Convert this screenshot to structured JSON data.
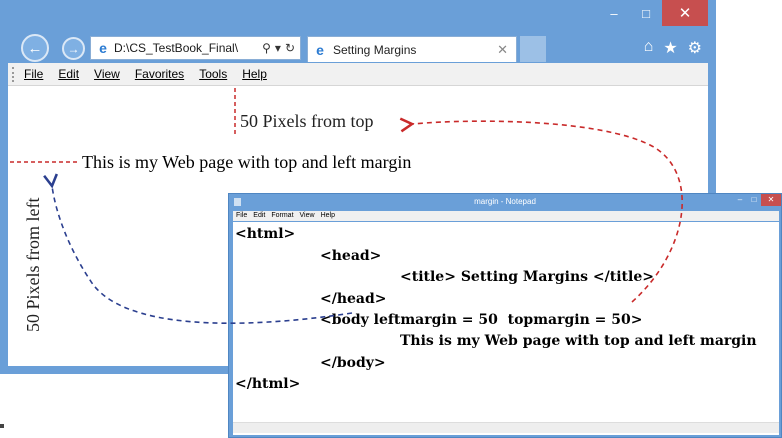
{
  "browser": {
    "url": "D:\\CS_TestBook_Final\\",
    "tab_title": "Setting Margins",
    "menu": [
      "File",
      "Edit",
      "View",
      "Favorites",
      "Tools",
      "Help"
    ],
    "window_buttons": {
      "minimize": "–",
      "maximize": "□",
      "close": "✕"
    }
  },
  "page": {
    "text": "This is my Web page with top and left margin"
  },
  "annotations": {
    "top": "50 Pixels from top",
    "left": "50 Pixels from left"
  },
  "notepad": {
    "title": "margin - Notepad",
    "menu": [
      "File",
      "Edit",
      "Format",
      "View",
      "Help"
    ],
    "lines": [
      "<html>",
      "<head>",
      "<title> Setting Margins </title>",
      "</head>",
      "<body leftmargin = 50  topmargin = 50>",
      "This is my Web page with top and left margin",
      "</body>",
      "</html>"
    ]
  },
  "colors": {
    "window_blue": "#6a9fd8",
    "arrow_red": "#c92a2a",
    "arrow_blue": "#2b3f8f",
    "close_red": "#c74f4f"
  }
}
